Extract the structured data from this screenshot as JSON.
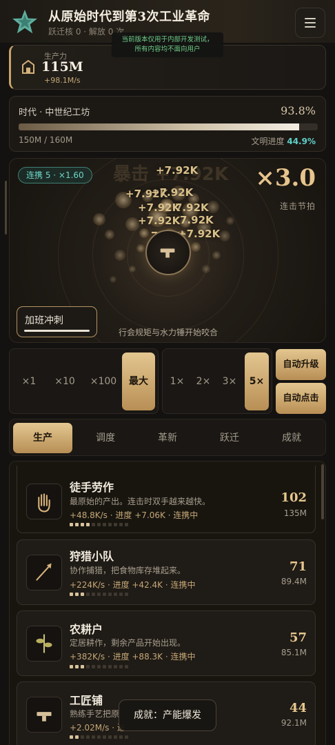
{
  "header": {
    "title": "从原始时代到第3次工业革命",
    "subtitle": "跃迁核 0 · 解放 0 次",
    "logo_icon": "star-icon",
    "menu_icon": "hamburger-menu-icon",
    "dev_notice_line1": "当前版本仅用于内部开发测试，",
    "dev_notice_line2": "所有内容均不面向用户"
  },
  "productivity": {
    "label": "生产力",
    "value": "115M",
    "rate": "+98.1M/s",
    "icon": "house-icon"
  },
  "era": {
    "label": "时代 · 中世纪工坊",
    "percent": "93.8%",
    "progress": 0.938,
    "count": "150M / 160M",
    "civ_label": "文明进度",
    "civ_value": "44.9%"
  },
  "arena": {
    "combo_badge": "连携 5 · ×1.60",
    "multiplier": "×3.0",
    "beat_label": "连击节拍",
    "crit_ghost": "暴击 +7.92K",
    "float_texts": [
      "+7.92K",
      "+7.92K",
      "+7.92K",
      "7.92K",
      "+7.92K",
      "7.92K",
      "+7.92K",
      "7.92K",
      "+7.92K"
    ],
    "sprint_label": "加班冲刺",
    "sprint_progress": 1.0,
    "caption": "行会规矩与水力锤开始咬合"
  },
  "buy_amounts": {
    "options": [
      "×1",
      "×10",
      "×100",
      "最大"
    ],
    "selected": "最大"
  },
  "speed": {
    "options": [
      "1×",
      "2×",
      "3×",
      "5×"
    ],
    "selected": "5×"
  },
  "auto": {
    "upgrade_label": "自动升级",
    "click_label": "自动点击"
  },
  "tabs": [
    "生产",
    "调度",
    "革新",
    "跃迁",
    "成就"
  ],
  "active_tab": "生产",
  "items": [
    {
      "name": "徒手劳作",
      "desc": "最原始的产出。连击时双手越来越快。",
      "stats": "+48.8K/s · 进度 +7.06K · 连携中",
      "level": "102",
      "cost": "135M",
      "icon": "hand-icon",
      "pips_filled": 4,
      "pips_total": 11
    },
    {
      "name": "狩猎小队",
      "desc": "协作捕猎，把食物库存堆起来。",
      "stats": "+224K/s · 进度 +42.4K · 连携中",
      "level": "71",
      "cost": "89.4M",
      "icon": "spear-icon",
      "pips_filled": 3,
      "pips_total": 11
    },
    {
      "name": "农耕户",
      "desc": "定居耕作，剩余产品开始出现。",
      "stats": "+382K/s · 进度 +88.3K · 连携中",
      "level": "57",
      "cost": "85.1M",
      "icon": "sprout-icon",
      "pips_filled": 3,
      "pips_total": 11
    },
    {
      "name": "工匠铺",
      "desc": "熟练手艺把原",
      "stats": "+2.02M/s · 进",
      "level": "44",
      "cost": "92.1M",
      "icon": "anvil-icon",
      "pips_filled": 2,
      "pips_total": 11
    }
  ],
  "toast": "成就：产能爆发",
  "colors": {
    "accent_gold": "#d9b57a",
    "teal": "#5fd0c8",
    "background": "#141210"
  }
}
